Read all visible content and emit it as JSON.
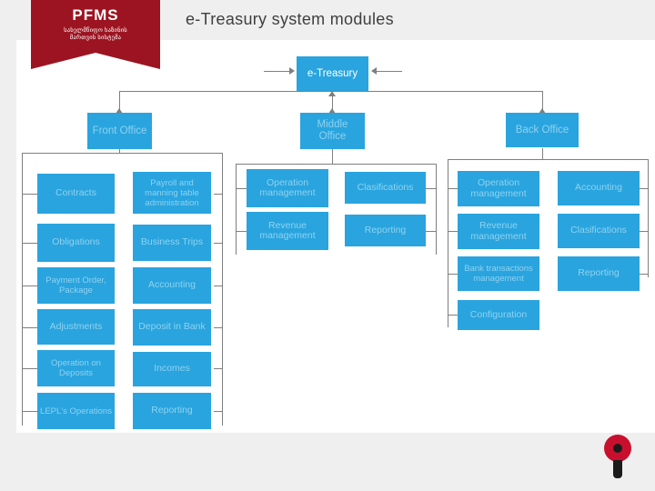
{
  "logo": {
    "title": "PFMS",
    "subtitle_line1": "სახელმწიფო ხაზინის",
    "subtitle_line2": "მართვის სისტემა"
  },
  "headline": "e-Treasury system modules",
  "nodes": {
    "root": "e-Treasury",
    "front_office": "Front Office",
    "middle_office": "Middle Office",
    "back_office": "Back Office",
    "front_col1": [
      "Contracts",
      "Obligations",
      "Payment Order, Package",
      "Adjustments",
      "Operation on Deposits",
      "LEPL's Operations"
    ],
    "front_col2": [
      "Payroll and manning table administration",
      "Business Trips",
      "Accounting",
      "Deposit in Bank",
      "Incomes",
      "Reporting"
    ],
    "middle_col1": [
      "Operation management",
      "Revenue management"
    ],
    "middle_col2": [
      "Clasifications",
      "Reporting"
    ],
    "back_col1": [
      "Operation management",
      "Revenue management",
      "Bank transactions management",
      "Configuration"
    ],
    "back_col2": [
      "Accounting",
      "Clasifications",
      "Reporting"
    ]
  },
  "colors": {
    "box": "#29a4de",
    "box_dim_text": "#8fd2f0",
    "logo": "#9c1421",
    "band": "#efefef",
    "connector": "#7f7f7f",
    "emblem_red": "#c8102e"
  }
}
